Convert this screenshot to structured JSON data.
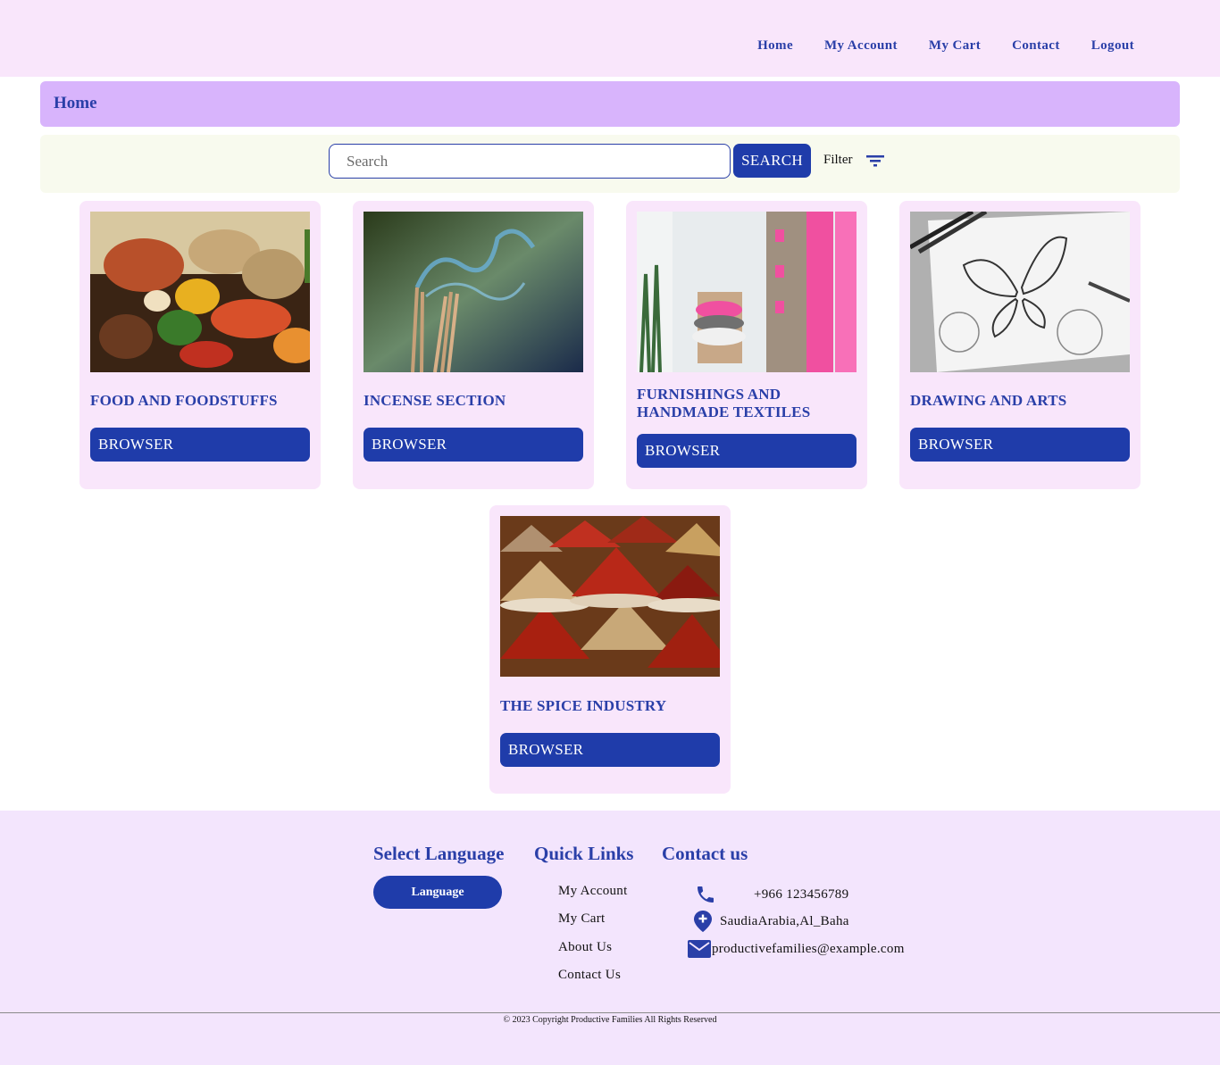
{
  "nav": {
    "items": [
      "Home",
      "My Account",
      "My Cart",
      "Contact",
      "Logout"
    ]
  },
  "breadcrumb": {
    "title": "Home"
  },
  "search": {
    "placeholder": "Search",
    "button_label": "SEARCH",
    "filter_label": "Filter"
  },
  "categories": [
    {
      "title": "FOOD AND FOODSTUFFS",
      "button": "BROWSER",
      "image": "food-image"
    },
    {
      "title": "INCENSE SECTION",
      "button": "BROWSER",
      "image": "incense-image"
    },
    {
      "title": "FURNISHINGS AND HANDMADE TEXTILES",
      "button": "BROWSER",
      "image": "textiles-image"
    },
    {
      "title": "DRAWING AND ARTS",
      "button": "BROWSER",
      "image": "butterfly-drawing-image"
    },
    {
      "title": "THE SPICE INDUSTRY",
      "button": "BROWSER",
      "image": "spices-image"
    }
  ],
  "footer": {
    "language": {
      "heading": "Select Language",
      "button": "Language"
    },
    "quick_links": {
      "heading": "Quick Links",
      "items": [
        "My Account",
        "My Cart",
        "About Us",
        "Contact Us"
      ]
    },
    "contact": {
      "heading": "Contact us",
      "phone": "+966 123456789",
      "location": "SaudiaArabia,Al_Baha",
      "email": "productivefamilies@example.com"
    },
    "copyright": "© 2023 Copyright Productive Families All Rights Reserved"
  },
  "colors": {
    "accent": "#1f3caa",
    "nav_bg": "#f9e6fb",
    "breadcrumb_bg": "#d8b4fc",
    "footer_bg": "#f3e5fd"
  }
}
